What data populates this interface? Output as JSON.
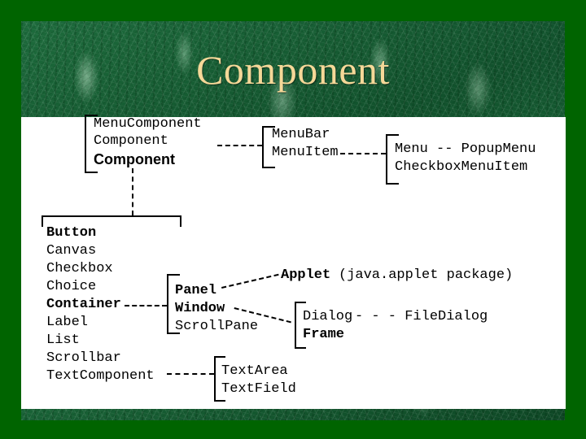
{
  "slide": {
    "title": "Component",
    "title_color": "#f5d898",
    "background_color": "#006400",
    "panel_color": "#ffffff",
    "marble_color": "#15572f"
  },
  "diagram": {
    "type": "class-hierarchy",
    "groups": [
      {
        "id": "root",
        "items": [
          {
            "label": "MenuComponent",
            "style": "mono"
          },
          {
            "label": "Component",
            "style": "mono"
          },
          {
            "label": "Component",
            "style": "sans-bold"
          }
        ]
      },
      {
        "id": "menu-level-1",
        "items": [
          {
            "label": "MenuBar",
            "style": "mono"
          },
          {
            "label": "MenuItem",
            "style": "mono"
          }
        ]
      },
      {
        "id": "menu-level-2",
        "items": [
          {
            "label": "Menu -- PopupMenu",
            "style": "mono"
          },
          {
            "label": "CheckboxMenuItem",
            "style": "mono"
          }
        ]
      },
      {
        "id": "component-children",
        "items": [
          {
            "label": "Button",
            "style": "mono-bold"
          },
          {
            "label": "Canvas",
            "style": "mono"
          },
          {
            "label": "Checkbox",
            "style": "mono"
          },
          {
            "label": "Choice",
            "style": "mono"
          },
          {
            "label": "Container",
            "style": "mono-bold"
          },
          {
            "label": "Label",
            "style": "mono"
          },
          {
            "label": "List",
            "style": "mono"
          },
          {
            "label": "Scrollbar",
            "style": "mono"
          },
          {
            "label": "TextComponent",
            "style": "mono"
          }
        ]
      },
      {
        "id": "container-children",
        "items": [
          {
            "label": "Panel",
            "style": "mono-bold"
          },
          {
            "label": "Window",
            "style": "mono-bold"
          },
          {
            "label": "ScrollPane",
            "style": "mono"
          }
        ]
      },
      {
        "id": "window-children",
        "items": [
          {
            "label": "Dialog",
            "style": "mono"
          },
          {
            "label": "Frame",
            "style": "mono-bold"
          }
        ]
      },
      {
        "id": "textcomponent-children",
        "items": [
          {
            "label": "TextArea",
            "style": "mono"
          },
          {
            "label": "TextField",
            "style": "mono"
          }
        ]
      }
    ],
    "standalone": {
      "applet": "Applet",
      "applet_note": "(java.applet package)",
      "filedialog": "- - - FileDialog"
    }
  }
}
